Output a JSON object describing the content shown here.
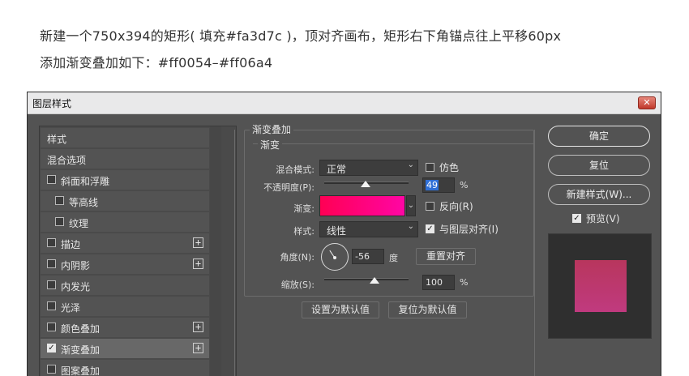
{
  "intro": {
    "line1": "新建一个750x394的矩形( 填充#fa3d7c )，顶对齐画布，矩形右下角锚点往上平移60px",
    "line2": "添加渐变叠加如下：#ff0054–#ff06a4"
  },
  "dialog": {
    "title": "图层样式",
    "close": "✕",
    "sidebar": {
      "items": [
        {
          "label": "样式",
          "checkbox": false
        },
        {
          "label": "混合选项",
          "checkbox": false
        },
        {
          "label": "斜面和浮雕",
          "checkbox": true,
          "checked": false
        },
        {
          "label": "等高线",
          "checkbox": true,
          "checked": false,
          "indent": true
        },
        {
          "label": "纹理",
          "checkbox": true,
          "checked": false,
          "indent": true
        },
        {
          "label": "描边",
          "checkbox": true,
          "checked": false,
          "plus": true
        },
        {
          "label": "内阴影",
          "checkbox": true,
          "checked": false,
          "plus": true
        },
        {
          "label": "内发光",
          "checkbox": true,
          "checked": false
        },
        {
          "label": "光泽",
          "checkbox": true,
          "checked": false
        },
        {
          "label": "颜色叠加",
          "checkbox": true,
          "checked": false,
          "plus": true
        },
        {
          "label": "渐变叠加",
          "checkbox": true,
          "checked": true,
          "plus": true,
          "active": true
        },
        {
          "label": "图案叠加",
          "checkbox": true,
          "checked": false
        }
      ]
    },
    "panel": {
      "group_title": "渐变叠加",
      "sub_title": "渐变",
      "blend_mode_label": "混合模式:",
      "blend_mode_value": "正常",
      "dither_label": "仿色",
      "opacity_label": "不透明度(P):",
      "opacity_value": "49",
      "opacity_unit": "%",
      "gradient_label": "渐变:",
      "gradient_from": "#ff0054",
      "gradient_to": "#ff06a4",
      "reverse_label": "反向(R)",
      "style_label": "样式:",
      "style_value": "线性",
      "align_label": "与图层对齐(I)",
      "angle_label": "角度(N):",
      "angle_value": "-56",
      "angle_unit": "度",
      "reset_align_button": "重置对齐",
      "scale_label": "缩放(S):",
      "scale_value": "100",
      "scale_unit": "%",
      "set_default_button": "设置为默认值",
      "reset_default_button": "复位为默认值",
      "opacity_level": 0.49,
      "scale_level": 1.0
    },
    "buttons": {
      "ok": "确定",
      "reset": "复位",
      "new_style": "新建样式(W)...",
      "preview_label": "预览(V)"
    }
  }
}
